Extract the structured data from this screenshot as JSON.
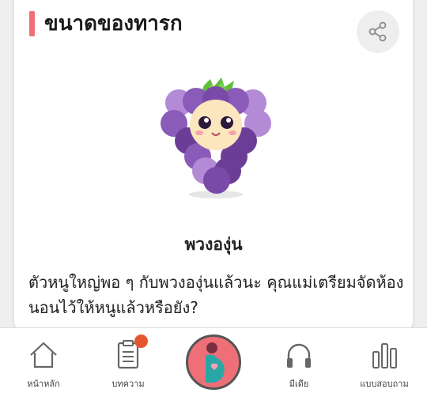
{
  "card": {
    "title": "ขนาดของทารก",
    "fruit_name": "พวงองุ่น",
    "description": "ตัวหนูใหญ่พอ ๆ กับพวงองุ่นแล้วนะ คุณแม่เตรียมจัดห้องนอนไว้ให้หนูแล้วหรือยัง?",
    "share_icon": "share-icon",
    "illustration": "grape-character"
  },
  "bottom_nav": {
    "items": [
      {
        "label": "หน้าหลัก",
        "icon": "home-icon"
      },
      {
        "label": "บทความ",
        "icon": "article-icon"
      },
      {
        "label": "",
        "icon": "pregnancy-icon"
      },
      {
        "label": "มีเดีย",
        "icon": "headphones-icon"
      },
      {
        "label": "แบบสอบถาม",
        "icon": "bar-chart-icon"
      }
    ]
  },
  "colors": {
    "accent": "#ef6f78",
    "badge": "#e4572e",
    "grape_dark": "#6b3d96",
    "grape_light": "#b28ad6",
    "leaf": "#5fbf3a"
  }
}
